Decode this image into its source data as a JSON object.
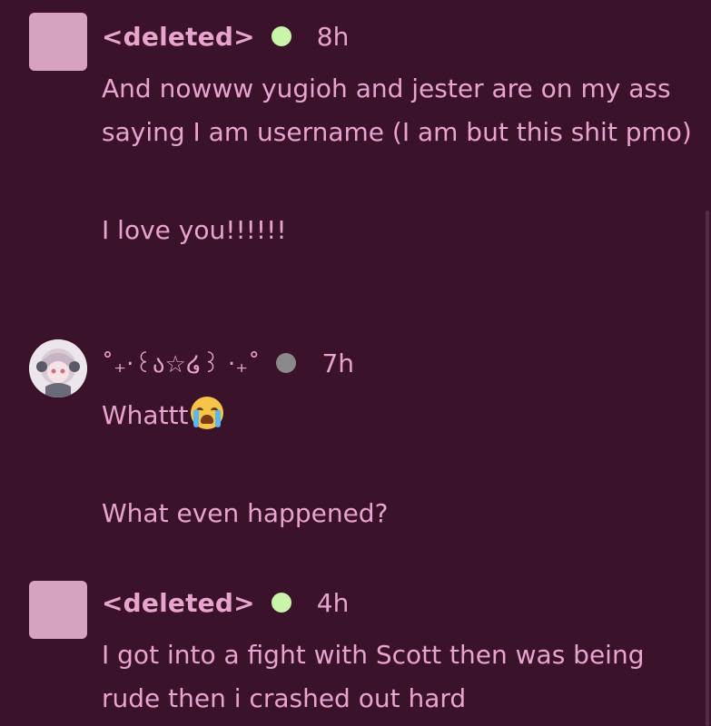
{
  "comments": [
    {
      "username": "<deleted>",
      "status": "online",
      "status_color": "#c9f5ab",
      "time": "8h",
      "paragraphs": [
        "And nowww yugioh and jester are on my ass saying I am username (I am but this shit pmo)",
        "I love you!!!!!!"
      ]
    },
    {
      "username": "˚₊‧꒰ა☆໒꒱ ‧₊˚",
      "status": "offline",
      "status_color": "#8a8a8a",
      "time": "7h",
      "paragraphs": [
        "Whattt",
        "What even happened?"
      ],
      "emoji": "loudly-crying-face-emoji"
    },
    {
      "username": "<deleted>",
      "status": "online",
      "status_color": "#c9f5ab",
      "time": "4h",
      "paragraphs": [
        "I got into a fight with Scott then was being rude then i crashed out hard"
      ]
    }
  ],
  "colors": {
    "background": "#3a1229",
    "text": "#e8a3cf",
    "avatar_placeholder": "#d6a2bf"
  }
}
